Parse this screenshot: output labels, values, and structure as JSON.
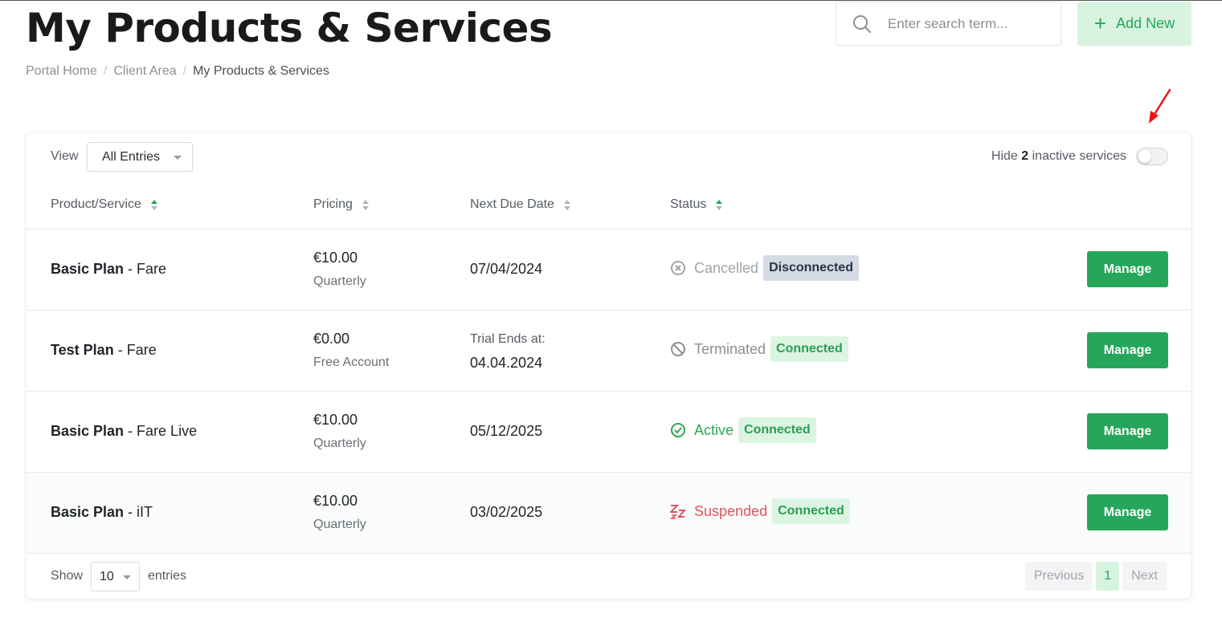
{
  "header": {
    "title": "My Products & Services",
    "breadcrumb": [
      "Portal Home",
      "Client Area",
      "My Products & Services"
    ],
    "search_placeholder": "Enter search term...",
    "add_new_label": "Add New"
  },
  "toolbar": {
    "view_label": "View",
    "view_value": "All Entries",
    "hide_prefix": "Hide",
    "hide_count": "2",
    "hide_suffix": "inactive services"
  },
  "columns": [
    "Product/Service",
    "Pricing",
    "Next Due Date",
    "Status"
  ],
  "rows": [
    {
      "product": "Basic Plan",
      "group": " - Fare",
      "amount": "€10.00",
      "cycle": "Quarterly",
      "due": "07/04/2024",
      "status": "Cancelled",
      "badge": "Disconnected",
      "action": "Manage"
    },
    {
      "product": "Test Plan",
      "group": " - Fare",
      "amount": "€0.00",
      "cycle": "Free Account",
      "due_label": "Trial Ends at:",
      "due": "04.04.2024",
      "status": "Terminated",
      "badge": "Connected",
      "action": "Manage"
    },
    {
      "product": "Basic Plan",
      "group": " - Fare Live",
      "amount": "€10.00",
      "cycle": "Quarterly",
      "due": "05/12/2025",
      "status": "Active",
      "badge": "Connected",
      "action": "Manage"
    },
    {
      "product": "Basic Plan",
      "group": " - iIT",
      "amount": "€10.00",
      "cycle": "Quarterly",
      "due": "03/02/2025",
      "status": "Suspended",
      "badge": "Connected",
      "action": "Manage"
    }
  ],
  "footer": {
    "show_label": "Show",
    "show_value": "10",
    "entries_label": "entries",
    "prev_label": "Previous",
    "page": "1",
    "next_label": "Next"
  },
  "colors": {
    "accent": "#26a65b",
    "cancelled": "#a0a5aa",
    "terminated": "#8a8f94",
    "active": "#2ea84f",
    "suspended": "#e0555c"
  }
}
